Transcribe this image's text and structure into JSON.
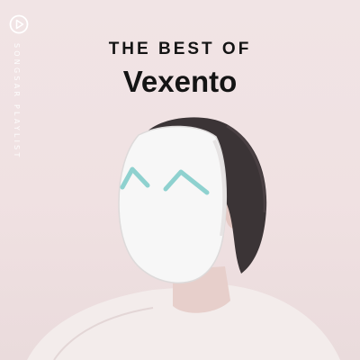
{
  "cover": {
    "pretitle": "THE BEST OF",
    "artist": "Vexento",
    "brand_vertical": "SONGSAR PLAYLIST",
    "brand_logo_icon": "play-triangle-circle-icon"
  },
  "colors": {
    "background": "#f1e4e5",
    "text": "#141414",
    "mask": "#f7f7f7",
    "mask_eyes": "#8ed1cf",
    "hair": "#3b3436",
    "shirt": "#f3eceb"
  }
}
